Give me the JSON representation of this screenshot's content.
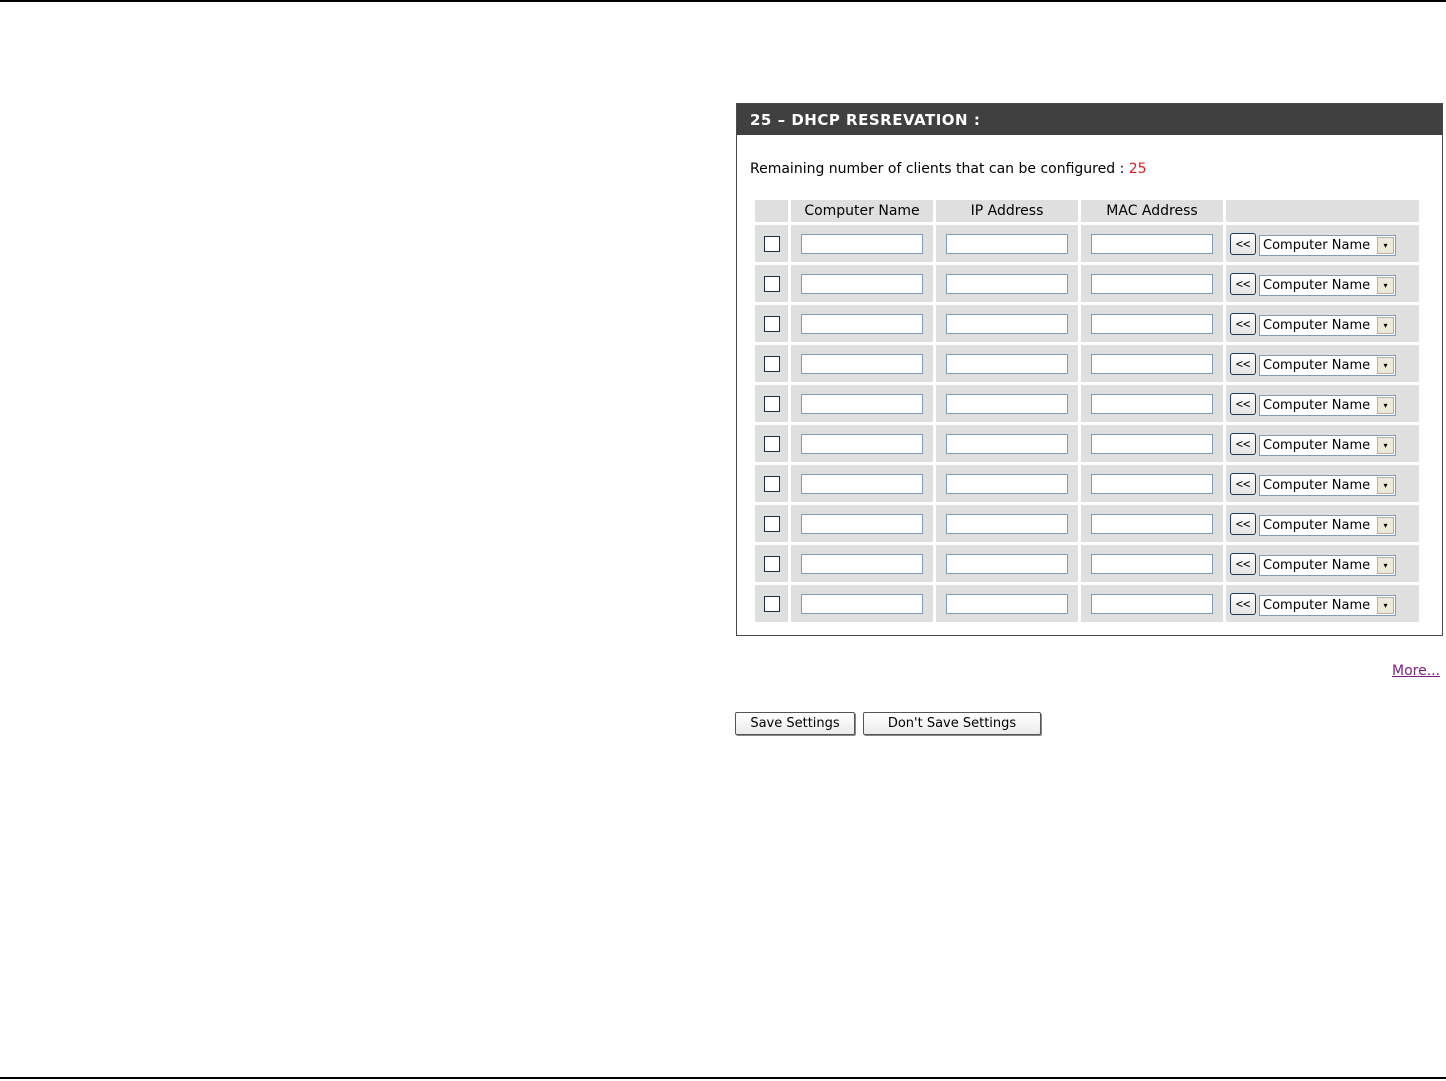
{
  "panel": {
    "title": "25 – DHCP RESREVATION :",
    "remaining_label": "Remaining number of clients that can be configured : ",
    "remaining_count": "25"
  },
  "table": {
    "headers": [
      "",
      "Computer Name",
      "IP Address",
      "MAC Address",
      ""
    ],
    "rows": 10,
    "copy_label": "<<",
    "select_value": "Computer Name",
    "dropdown_arrow": "▾"
  },
  "links": {
    "more": "More..."
  },
  "buttons": {
    "save": "Save Settings",
    "dont_save": "Don't Save Settings"
  },
  "icons": {
    "dropdown": "chevron-down-icon",
    "checkbox": "checkbox-icon"
  }
}
